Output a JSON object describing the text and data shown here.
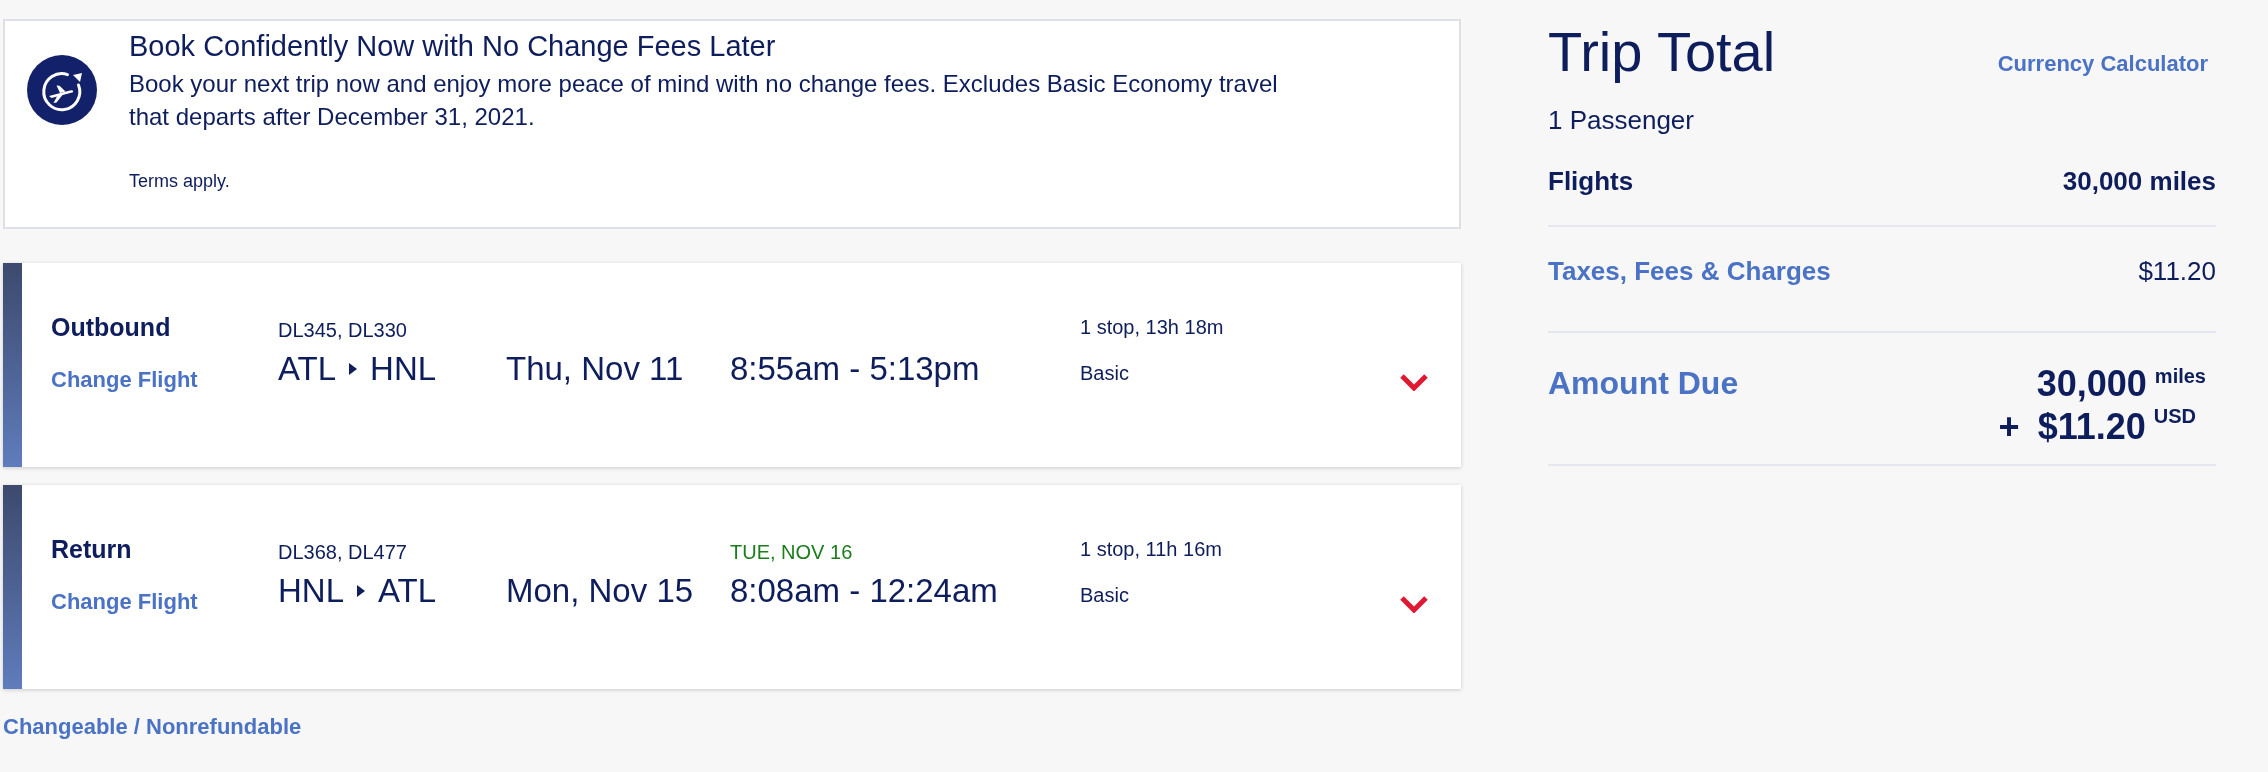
{
  "promo_banner": {
    "title": "Book Confidently Now with No Change Fees Later",
    "body": "Book your next trip now and enjoy more peace of mind with no change fees. Excludes Basic Economy travel that departs after December 31, 2021.",
    "terms": "Terms apply."
  },
  "flights": [
    {
      "label": "Outbound",
      "change_link": "Change Flight",
      "flight_numbers": "DL345, DL330",
      "origin": "ATL",
      "destination": "HNL",
      "date": "Thu, Nov 11",
      "times": "8:55am - 5:13pm",
      "stops": "1 stop, 13h 18m",
      "fare": "Basic",
      "expanded": false
    },
    {
      "label": "Return",
      "change_link": "Change Flight",
      "flight_numbers": "DL368, DL477",
      "origin": "HNL",
      "destination": "ATL",
      "date": "Mon, Nov 15",
      "arrival_note": "TUE, NOV 16",
      "times": "8:08am - 12:24am",
      "stops": "1 stop, 11h 16m",
      "fare": "Basic",
      "expanded": false
    }
  ],
  "fare_rules_link": "Changeable / Nonrefundable",
  "trip_total": {
    "title": "Trip Total",
    "currency_link": "Currency Calculator",
    "passengers": "1 Passenger",
    "lines": [
      {
        "kind": "plain",
        "label": "Flights",
        "value": "30,000 miles"
      },
      {
        "kind": "link",
        "label": "Taxes, Fees & Charges",
        "value": "$11.20"
      }
    ],
    "amount_due": {
      "label": "Amount Due",
      "miles": "30,000",
      "miles_unit": "miles",
      "plus": "+",
      "cash": "$11.20",
      "cash_unit": "USD"
    }
  }
}
